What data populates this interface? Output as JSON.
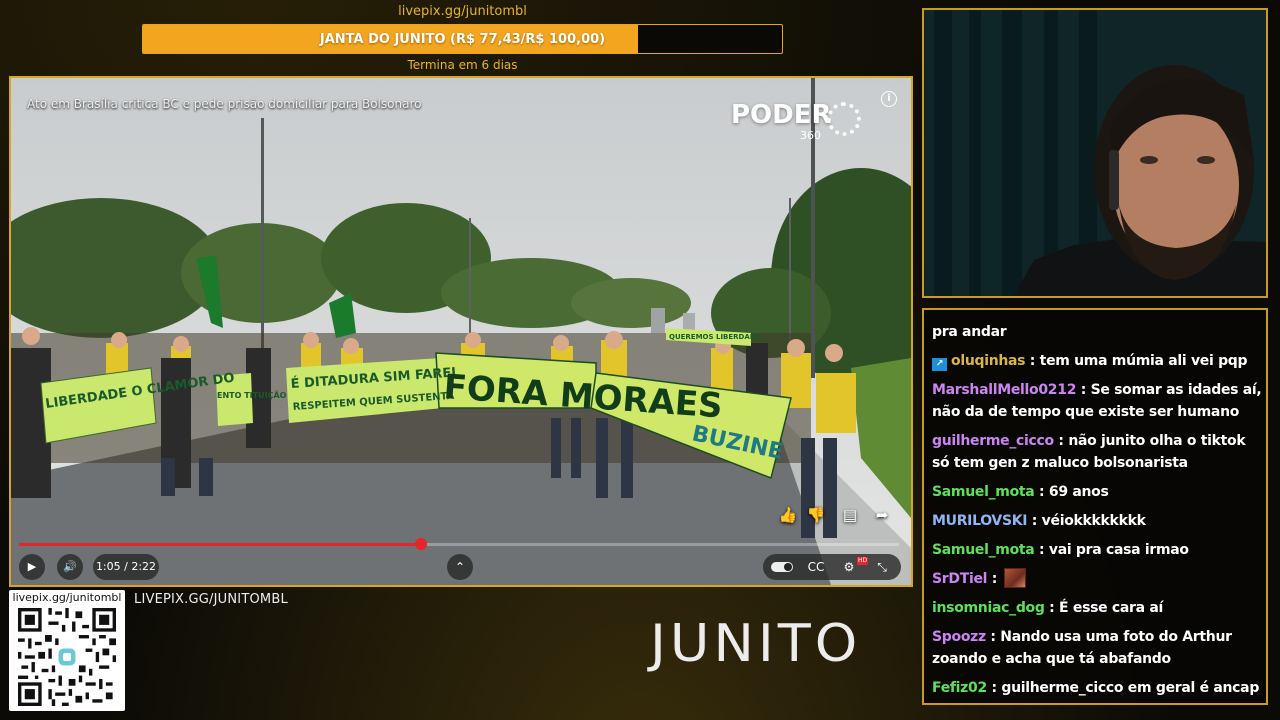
{
  "goal": {
    "url": "livepix.gg/junitombl",
    "label": "JANTA DO JUNITO (R$ 77,43/R$ 100,00)",
    "current": 77.43,
    "target": 100.0,
    "ends_text": "Termina em 6 dias",
    "bar_color": "#f3a51f"
  },
  "video": {
    "title": "Ato em Brasília critica BC e pede prisão domiciliar para Bolsonaro",
    "channel_logo": "PODER",
    "channel_logo_sub": "360",
    "time_display": "1:05 / 2:22",
    "progress_fraction": 0.4568,
    "progress_color": "#e6242c",
    "banners": {
      "main": "FORA MORAES",
      "buzine": "BUZINE",
      "left": "LIBERDADE O CLAMOR DO",
      "middle": "É DITADURA SIM FAREI",
      "middle_sub": "RESPEITEM QUEM SUSTENTA",
      "small": "QUEREMOS LIBERDADE",
      "side": "ENTO TITUIÇÃO"
    },
    "icons": {
      "info": "info-icon",
      "like": "thumbs-up-icon",
      "dislike": "thumbs-down-icon",
      "comments": "comment-icon",
      "share": "share-icon",
      "play": "play-icon",
      "volume": "volume-icon",
      "chapters": "chevron-up-icon",
      "autoplay": "autoplay-toggle",
      "captions": "captions-icon",
      "settings": "settings-icon",
      "fullscreen": "fullscreen-icon"
    },
    "glyphs": {
      "info": "i",
      "like": "👍",
      "dislike": "👎",
      "comments": "▤",
      "share": "➦",
      "play": "▶",
      "volume": "🔊",
      "chapters": "⌃",
      "captions": "CC",
      "settings": "⚙",
      "hd": "HD",
      "fullscreen": "⤡"
    }
  },
  "branding": {
    "qr_url": "livepix.gg/junitombl",
    "livepix_banner": "LIVEPIX.GG/JUNITOMBL",
    "logo": "JUNITO"
  },
  "chat": {
    "messages": [
      {
        "user": "",
        "color": "#ffffff",
        "text": "pra andar",
        "badge": false
      },
      {
        "user": "oluqinhas",
        "color": "#d8b64a",
        "text": "tem uma múmia ali vei pqp",
        "badge": true
      },
      {
        "user": "MarshallMello0212",
        "color": "#c986f2",
        "text": "Se somar as idades aí, não da de tempo que existe ser humano",
        "badge": false
      },
      {
        "user": "guilherme_cicco",
        "color": "#c986f2",
        "text": "não junito olha o tiktok só tem gen z maluco bolsonarista",
        "badge": false
      },
      {
        "user": "Samuel_mota",
        "color": "#5fe05a",
        "text": "69 anos",
        "badge": false
      },
      {
        "user": "MURILOVSKI",
        "color": "#8fb6f0",
        "text": "véiokkkkkkkk",
        "badge": false
      },
      {
        "user": "Samuel_mota",
        "color": "#5fe05a",
        "text": "vai pra casa irmao",
        "badge": false
      },
      {
        "user": "SrDTiel",
        "color": "#c986f2",
        "text": "",
        "badge": false,
        "emote": true
      },
      {
        "user": "insomniac_dog",
        "color": "#5fe05a",
        "text": "É esse cara aí",
        "badge": false
      },
      {
        "user": "Spoozz",
        "color": "#c986f2",
        "text": "Nando usa uma foto do Arthur zoando e acha que tá abafando",
        "badge": false
      },
      {
        "user": "Fefiz02",
        "color": "#5fe05a",
        "text": "guilherme_cicco em geral é ancap",
        "badge": false
      }
    ],
    "badge_glyph": "↗",
    "emote_name": "chat-emote"
  }
}
